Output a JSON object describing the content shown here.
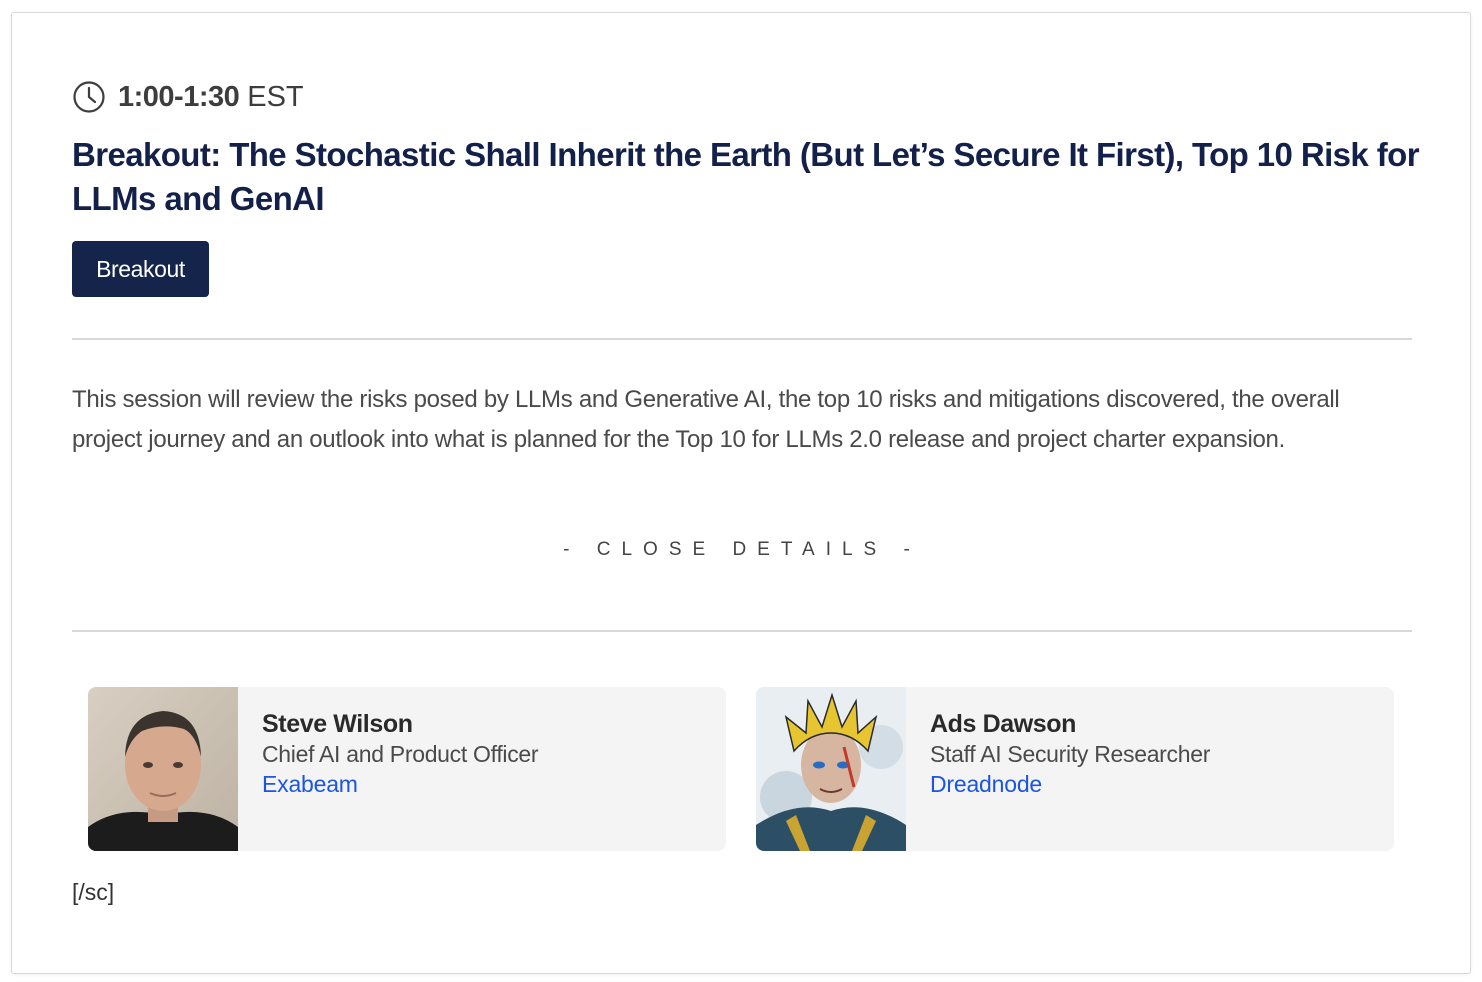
{
  "session": {
    "time": "1:00-1:30",
    "timezone": "EST",
    "title": "Breakout: The Stochastic Shall Inherit the Earth (But Let’s Secure It First), Top 10 Risk for LLMs and GenAI",
    "tag_label": "Breakout",
    "description": "This session will review the risks posed by LLMs and Generative AI, the top 10 risks and mitigations discovered, the overall project journey and an outlook into what is planned for the Top 10 for LLMs 2.0 release and project charter expansion.",
    "close_details_label": "- CLOSE DETAILS -"
  },
  "speakers": [
    {
      "name": "Steve Wilson",
      "role": "Chief AI and Product Officer",
      "company": "Exabeam",
      "photo_icon": "speaker-photo"
    },
    {
      "name": "Ads Dawson",
      "role": "Staff AI Security Researcher",
      "company": "Dreadnode",
      "photo_icon": "speaker-avatar-illustration"
    }
  ],
  "footer": {
    "shortcode_text": "[/sc]"
  },
  "colors": {
    "title": "#13204a",
    "tag_background": "#14244b",
    "link": "#1a55e3",
    "card_background": "#f4f4f4"
  }
}
